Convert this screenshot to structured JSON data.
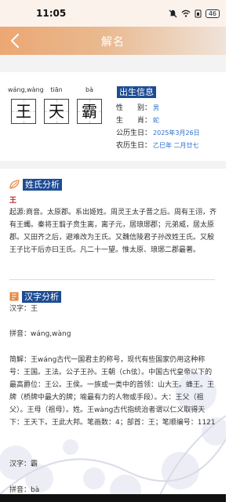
{
  "status": {
    "time": "11:05",
    "battery": "46"
  },
  "header": {
    "title": "解名"
  },
  "name": {
    "chars": [
      {
        "pinyin": "wáng,wàng",
        "char": "王"
      },
      {
        "pinyin": "tiān",
        "char": "天"
      },
      {
        "pinyin": "bà",
        "char": "霸"
      }
    ]
  },
  "birth": {
    "title": "出生信息",
    "rows": [
      {
        "label": "性　　别：",
        "value": "男"
      },
      {
        "label": "生　　肖：",
        "value": "蛇"
      },
      {
        "label": "公历生日：",
        "value": "2025年3月26日"
      },
      {
        "label": "农历生日：",
        "value": "乙巳年 二月廿七"
      }
    ]
  },
  "surname": {
    "title": "姓氏分析",
    "char": "王",
    "text": "起源:商音。太原郡。系出姬姓。周灵王太子晋之后。周有王诩，齐有王蠋。秦将王翦子贲生离，离子元，居琅琊郡；元弟威，居太原郡。又田齐之后，避难改为王氏。又魏信陵君子孙改姓王氏。又殷王子比干后亦曰王氏。凡二十一望。惟太原、琅琊二郡最著。"
  },
  "hanzi": {
    "title": "汉字分析",
    "label_char1": "汉字：王",
    "label_pinyin1": "拼音：wáng,wàng",
    "desc1": "简解：王wáng古代一国君主的称号，现代有些国家仍用这种称号：王国。王法。公子王孙。王朝（ch伭）。中国古代皇帝以下的最高爵位：王公。王侯。一族或一类中的首领：山大王。蜂王。王牌（桥牌中最大的牌；喻最有力的人物或手段）。大：王父（祖父）。王母（祖母）。姓。王wàng古代指统治者谓以仁义取得天下：王天下。王此大邦。笔画数：4；部首：王；笔顺编号：1121",
    "label_char2": "汉字：霸",
    "label_pinyin2": "拼音：bà"
  },
  "colors": {
    "accent": "#1d4c93",
    "header_start": "#eca773",
    "value": "#2b6fd0"
  }
}
